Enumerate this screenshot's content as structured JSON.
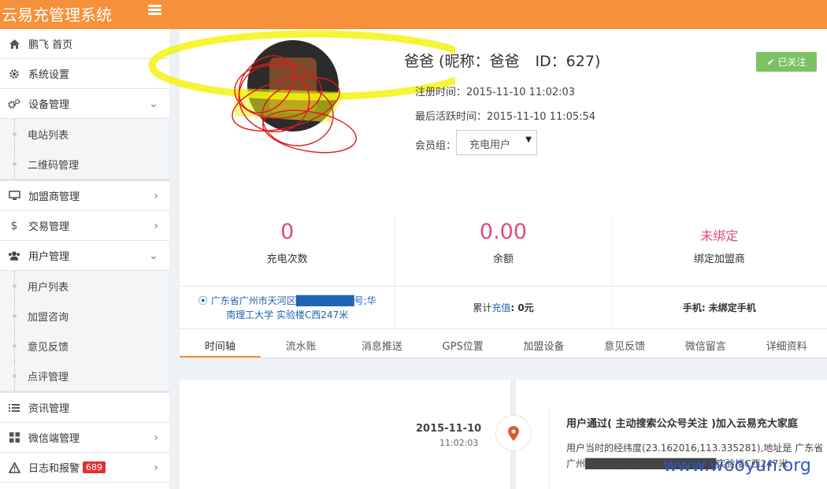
{
  "header": {
    "title": "云易充管理系统"
  },
  "sidebar": {
    "items": [
      {
        "label": "鹏飞 首页"
      },
      {
        "label": "系统设置"
      },
      {
        "label": "设备管理",
        "sub": [
          "电站列表",
          "二维码管理"
        ]
      },
      {
        "label": "加盟商管理"
      },
      {
        "label": "交易管理"
      },
      {
        "label": "用户管理",
        "sub": [
          "用户列表",
          "加盟咨询",
          "意见反馈",
          "点评管理"
        ]
      },
      {
        "label": "资讯管理"
      },
      {
        "label": "微信端管理"
      },
      {
        "label": "日志和报警",
        "badge": "689"
      }
    ]
  },
  "profile": {
    "name": "爸爸 (昵称：爸爸",
    "id": "ID：627)",
    "register": "注册时间：2015-11-10 11:02:03",
    "last_active": "最后活跃时间：2015-11-10 11:05:54",
    "group_label": "会员组：",
    "group_value": "充电用户",
    "follow": "已关注"
  },
  "stats": [
    {
      "value": "0",
      "label": "充电次数"
    },
    {
      "value": "0.00",
      "label": "余额"
    },
    {
      "value": "未绑定",
      "label": "绑定加盟商"
    }
  ],
  "info": {
    "address": "广东省广州市天河区████████号;华南理工大学 实验楼C西247米",
    "recharge_prefix": "累计",
    "recharge_link": "充值",
    "recharge_suffix": ": 0元",
    "phone": "手机: 未绑定手机"
  },
  "tabs": [
    "时间轴",
    "流水账",
    "消息推送",
    "GPS位置",
    "加盟设备",
    "意见反馈",
    "微信留言",
    "详细资料"
  ],
  "timeline": {
    "date": "2015-11-10",
    "time": "11:02:03",
    "title": "用户通过( 主动搜索公众号关注 )加入云易充大家庭",
    "body": "用户当时的经纬度(23.162016,113.335281),地址是 广东省广州██████████████████实验楼C西247米"
  },
  "watermark": "www.wooyun.org",
  "colors": {
    "header": "#f7903a",
    "accent": "#e14b7f",
    "follow": "#7cc163"
  }
}
